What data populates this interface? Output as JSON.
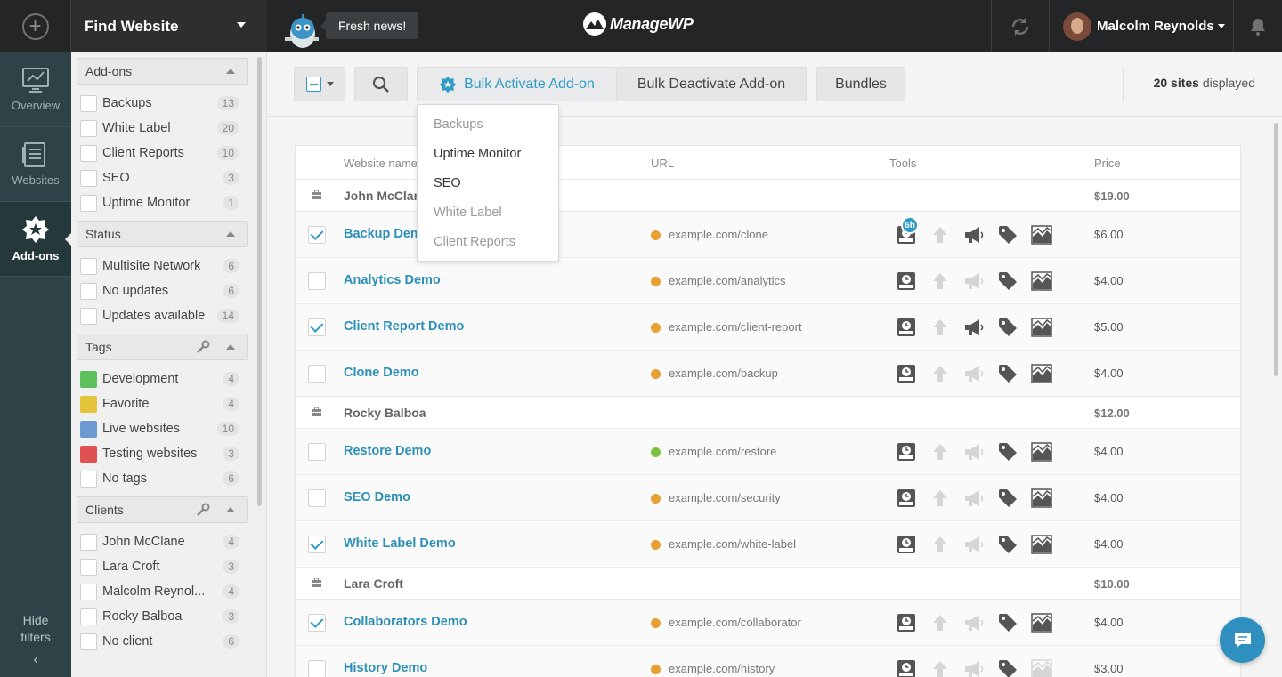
{
  "topbar": {
    "find_label": "Find Website",
    "news_label": "Fresh news!",
    "brand": "ManageWP",
    "user_name": "Malcolm Reynolds"
  },
  "nav": [
    {
      "label": "Overview",
      "icon": "monitor-chart-icon"
    },
    {
      "label": "Websites",
      "icon": "websites-list-icon"
    },
    {
      "label": "Add-ons",
      "icon": "addon-badge-icon"
    }
  ],
  "hide_filters": {
    "line1": "Hide",
    "line2": "filters"
  },
  "filters": {
    "addons": {
      "title": "Add-ons",
      "items": [
        {
          "label": "Backups",
          "count": "13"
        },
        {
          "label": "White Label",
          "count": "20"
        },
        {
          "label": "Client Reports",
          "count": "10"
        },
        {
          "label": "SEO",
          "count": "3"
        },
        {
          "label": "Uptime Monitor",
          "count": "1"
        }
      ]
    },
    "status": {
      "title": "Status",
      "items": [
        {
          "label": "Multisite Network",
          "count": "6"
        },
        {
          "label": "No updates",
          "count": "6"
        },
        {
          "label": "Updates available",
          "count": "14"
        }
      ]
    },
    "tags": {
      "title": "Tags",
      "items": [
        {
          "label": "Development",
          "count": "4",
          "color": "#5cc15c"
        },
        {
          "label": "Favorite",
          "count": "4",
          "color": "#e3c43a"
        },
        {
          "label": "Live websites",
          "count": "10",
          "color": "#6b9ad3"
        },
        {
          "label": "Testing websites",
          "count": "3",
          "color": "#e05252"
        },
        {
          "label": "No tags",
          "count": "6"
        }
      ]
    },
    "clients": {
      "title": "Clients",
      "items": [
        {
          "label": "John McClane",
          "count": "4"
        },
        {
          "label": "Lara Croft",
          "count": "3"
        },
        {
          "label": "Malcolm Reynol...",
          "count": "4"
        },
        {
          "label": "Rocky Balboa",
          "count": "3"
        },
        {
          "label": "No client",
          "count": "6"
        }
      ]
    }
  },
  "toolbar": {
    "bulk_activate": "Bulk Activate Add-on",
    "bulk_deactivate": "Bulk Deactivate Add-on",
    "bundles": "Bundles",
    "count_bold": "20 sites",
    "count_rest": " displayed"
  },
  "dropdown": [
    {
      "label": "Backups",
      "enabled": false
    },
    {
      "label": "Uptime Monitor",
      "enabled": true
    },
    {
      "label": "SEO",
      "enabled": true
    },
    {
      "label": "White Label",
      "enabled": false
    },
    {
      "label": "Client Reports",
      "enabled": false
    }
  ],
  "table": {
    "headers": {
      "name": "Website name",
      "url": "URL",
      "tools": "Tools",
      "price": "Price"
    },
    "rows": [
      {
        "type": "group",
        "name": "John McClane",
        "price": "$19.00"
      },
      {
        "type": "site",
        "name": "Backup Demo",
        "url": "example.com/clone",
        "price": "$6.00",
        "checked": true,
        "globe": "#e8a033",
        "badge": "6h",
        "tools": [
          1,
          0,
          1,
          1,
          1
        ]
      },
      {
        "type": "site",
        "name": "Analytics Demo",
        "url": "example.com/analytics",
        "price": "$4.00",
        "checked": false,
        "globe": "#e8a033",
        "tools": [
          1,
          0,
          0,
          1,
          1
        ]
      },
      {
        "type": "site",
        "name": "Client Report Demo",
        "url": "example.com/client-report",
        "price": "$5.00",
        "checked": true,
        "globe": "#e8a033",
        "tools": [
          1,
          0,
          1,
          1,
          1
        ]
      },
      {
        "type": "site",
        "name": "Clone Demo",
        "url": "example.com/backup",
        "price": "$4.00",
        "checked": false,
        "globe": "#e8a033",
        "tools": [
          1,
          0,
          0,
          1,
          1
        ]
      },
      {
        "type": "group",
        "name": "Rocky Balboa",
        "price": "$12.00"
      },
      {
        "type": "site",
        "name": "Restore Demo",
        "url": "example.com/restore",
        "price": "$4.00",
        "checked": false,
        "globe": "#7cc242",
        "tools": [
          1,
          0,
          0,
          1,
          1
        ]
      },
      {
        "type": "site",
        "name": "SEO Demo",
        "url": "example.com/security",
        "price": "$4.00",
        "checked": false,
        "globe": "#e8a033",
        "tools": [
          1,
          0,
          0,
          1,
          1
        ]
      },
      {
        "type": "site",
        "name": "White Label Demo",
        "url": "example.com/white-label",
        "price": "$4.00",
        "checked": true,
        "globe": "#e8a033",
        "tools": [
          1,
          0,
          0,
          1,
          1
        ]
      },
      {
        "type": "group",
        "name": "Lara Croft",
        "price": "$10.00"
      },
      {
        "type": "site",
        "name": "Collaborators Demo",
        "url": "example.com/collaborator",
        "price": "$4.00",
        "checked": true,
        "globe": "#e8a033",
        "tools": [
          1,
          0,
          0,
          1,
          1
        ]
      },
      {
        "type": "site",
        "name": "History Demo",
        "url": "example.com/history",
        "price": "$3.00",
        "checked": false,
        "globe": "#e8a033",
        "tools": [
          1,
          0,
          0,
          1,
          0
        ]
      }
    ]
  }
}
